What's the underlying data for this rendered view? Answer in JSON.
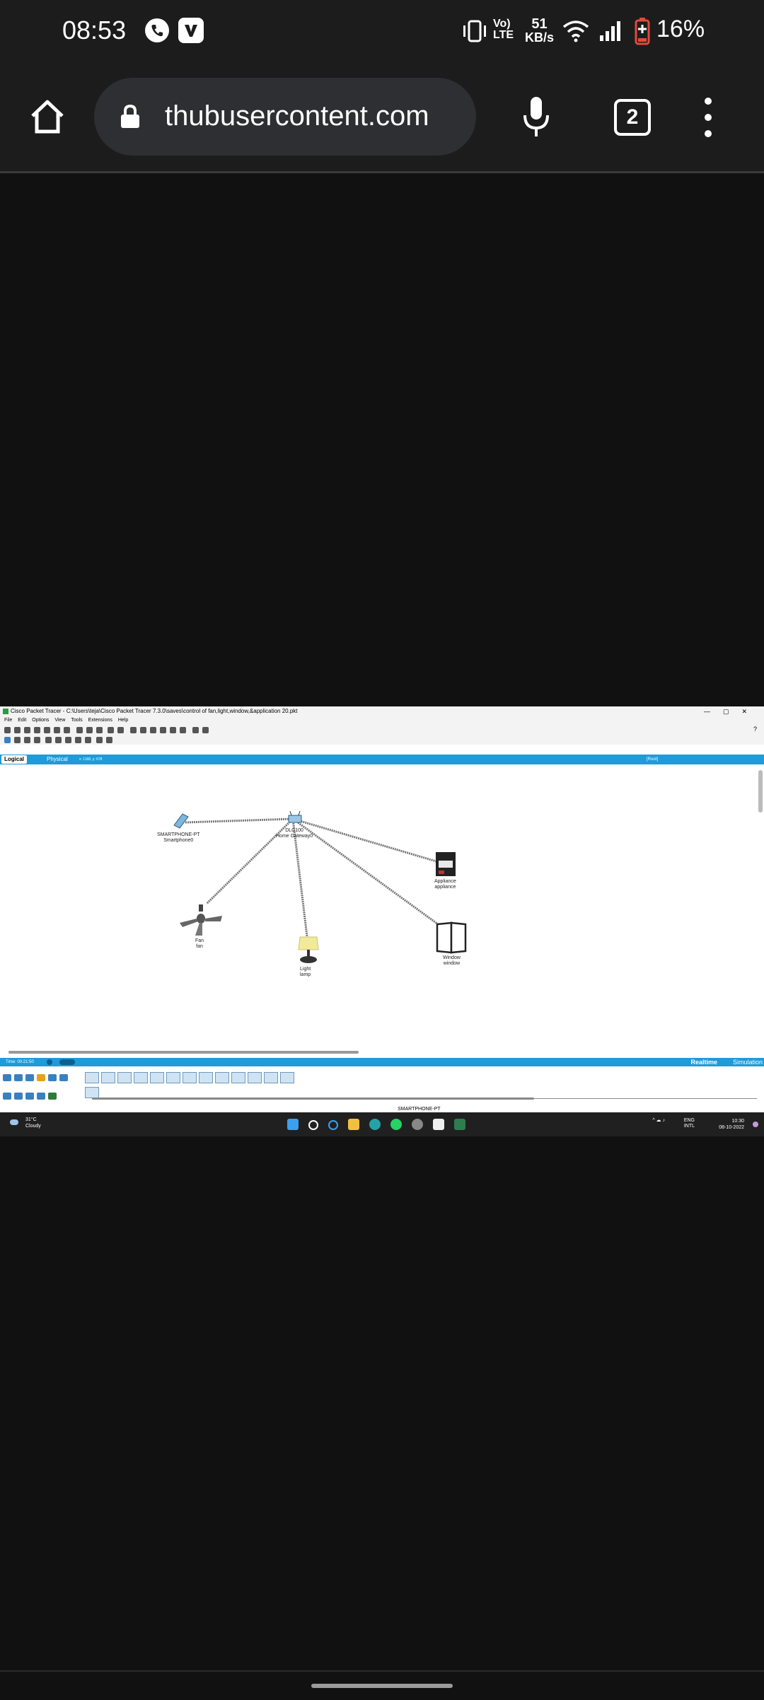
{
  "status_bar": {
    "time": "08:53",
    "volte_top": "Vo)",
    "volte_bottom": "LTE",
    "net_speed_value": "51",
    "net_speed_unit": "KB/s",
    "battery_percent": "16%",
    "icons": [
      "phone-call-icon",
      "vivaldi-icon",
      "vibrate-icon",
      "volte-icon",
      "wifi-icon",
      "signal-icon",
      "battery-low-icon"
    ]
  },
  "browser": {
    "url": "thubusercontent.com",
    "tab_count": "2",
    "icons": [
      "home-icon",
      "lock-icon",
      "mic-icon",
      "tabs-icon",
      "overflow-menu-icon"
    ]
  },
  "packet_tracer": {
    "window_title": "Cisco Packet Tracer - C:\\Users\\teja\\Cisco Packet Tracer 7.3.0\\saves\\control of fan,light,window,&application 20.pkt",
    "window_buttons": [
      "—",
      "▢",
      "✕"
    ],
    "menu": [
      "File",
      "Edit",
      "Options",
      "View",
      "Tools",
      "Extensions",
      "Help"
    ],
    "help_glyph": "?",
    "tab_logical": "Logical",
    "tab_physical": "Physical",
    "coords": "x: 1168, y: 678",
    "root_label": "[Root]",
    "nodes": {
      "smartphone": {
        "line1": "SMARTPHONE-PT",
        "line2": "Smartphone0"
      },
      "gateway": {
        "line1": "DLC100",
        "line2": "Home Gateway0"
      },
      "appliance": {
        "line1": "Appliance",
        "line2": "appliance"
      },
      "fan": {
        "line1": "Fan",
        "line2": "fan"
      },
      "light": {
        "line1": "Light",
        "line2": "lamp"
      },
      "window": {
        "line1": "Window",
        "line2": "window"
      }
    },
    "time_label": "Time: 00:21:50",
    "realtime": "Realtime",
    "simulation": "Simulation",
    "selected_device_label": "SMARTPHONE-PT"
  },
  "taskbar": {
    "temp": "31°C",
    "condition": "Cloudy",
    "lang_top": "ENG",
    "lang_bottom": "INTL",
    "clock_time": "10:30",
    "clock_date": "08-10-2022",
    "icons": [
      "windows-start-icon",
      "search-icon",
      "cortana-icon",
      "file-explorer-icon",
      "edge-icon",
      "whatsapp-icon",
      "dell-icon",
      "store-icon",
      "packet-tracer-icon"
    ]
  },
  "colors": {
    "pt_blue": "#1f9bd7",
    "dark_bg": "#111111",
    "pill_bg": "#2d2f33",
    "battery_red": "#e24a3b"
  }
}
